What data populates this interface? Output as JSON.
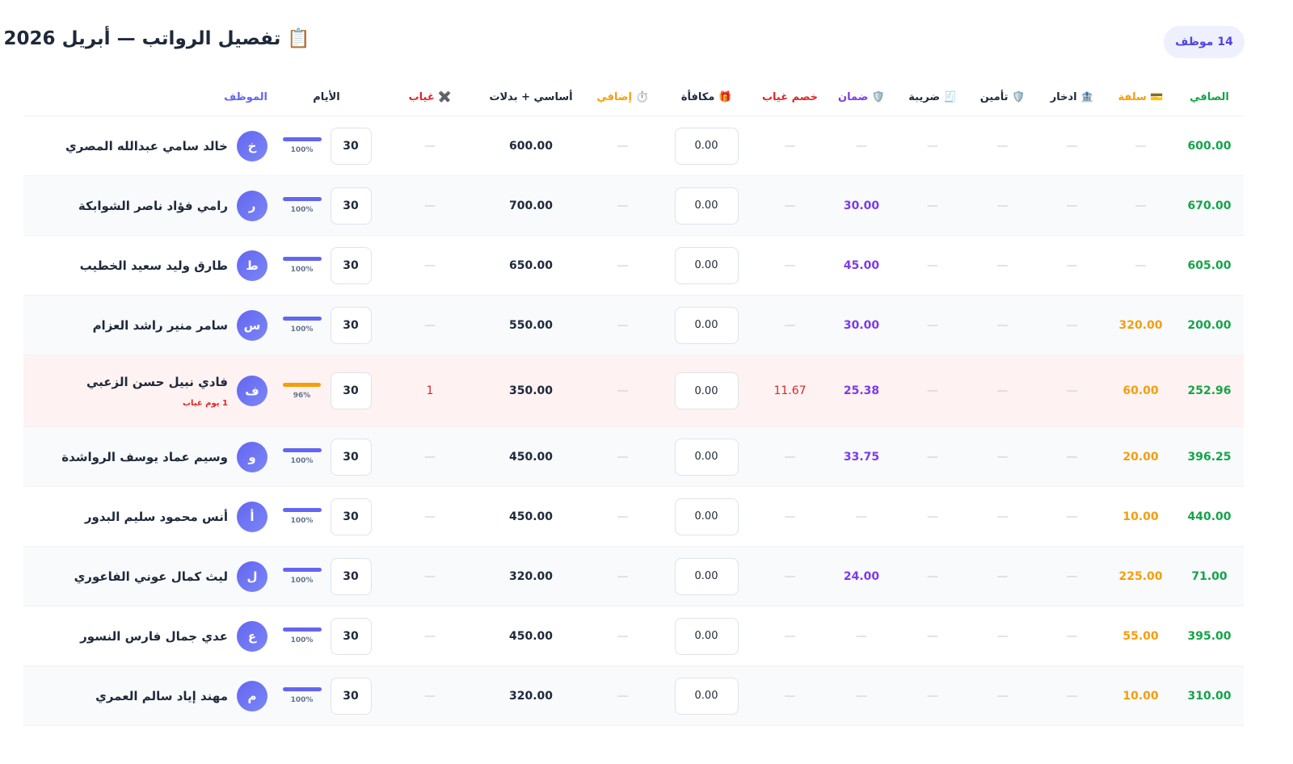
{
  "header": {
    "title": "📋 تفصيل الرواتب — أبريل 2026",
    "employee_count": "14 موظف"
  },
  "columns": {
    "employee": "الموظف",
    "days": "الأيام",
    "absence": "✖️ غياب",
    "base": "أساسي + بدلات",
    "overtime": "⏱️ إضافي",
    "bonus": "🎁 مكافأة",
    "absence_deduction": "خصم غياب",
    "guarantee": "🛡️ ضمان",
    "tax": "🧾 ضريبة",
    "insurance": "🛡️ تأمين",
    "savings": "🏦 ادخار",
    "loan": "💳 سلفة",
    "net": "الصافي"
  },
  "colors": {
    "accent": "#6366f1",
    "net": "#16a34a",
    "loan": "#f59e0b",
    "guarantee": "#7c3aed",
    "deduction": "#dc2626"
  },
  "dash": "—",
  "rows": [
    {
      "initial": "خ",
      "name": "خالد سامي عبدالله المصري",
      "note": "",
      "days": "30",
      "pct": "100%",
      "pct_value": 1.0,
      "absence": "—",
      "base": "600.00",
      "overtime": "—",
      "bonus": "0.00",
      "absence_deduction": "—",
      "guarantee": "—",
      "tax": "—",
      "insurance": "—",
      "savings": "—",
      "loan": "—",
      "net": "600.00"
    },
    {
      "initial": "ر",
      "name": "رامي فؤاد ناصر الشوابكة",
      "note": "",
      "days": "30",
      "pct": "100%",
      "pct_value": 1.0,
      "absence": "—",
      "base": "700.00",
      "overtime": "—",
      "bonus": "0.00",
      "absence_deduction": "—",
      "guarantee": "30.00",
      "tax": "—",
      "insurance": "—",
      "savings": "—",
      "loan": "—",
      "net": "670.00"
    },
    {
      "initial": "ط",
      "name": "طارق وليد سعيد الخطيب",
      "note": "",
      "days": "30",
      "pct": "100%",
      "pct_value": 1.0,
      "absence": "—",
      "base": "650.00",
      "overtime": "—",
      "bonus": "0.00",
      "absence_deduction": "—",
      "guarantee": "45.00",
      "tax": "—",
      "insurance": "—",
      "savings": "—",
      "loan": "—",
      "net": "605.00"
    },
    {
      "initial": "س",
      "name": "سامر منير راشد العزام",
      "note": "",
      "days": "30",
      "pct": "100%",
      "pct_value": 1.0,
      "absence": "—",
      "base": "550.00",
      "overtime": "—",
      "bonus": "0.00",
      "absence_deduction": "—",
      "guarantee": "30.00",
      "tax": "—",
      "insurance": "—",
      "savings": "—",
      "loan": "320.00",
      "net": "200.00"
    },
    {
      "initial": "ف",
      "name": "فادي نبيل حسن الزعبي",
      "note": "1 يوم غياب",
      "days": "30",
      "pct": "96%",
      "pct_value": 0.96,
      "absence": "1",
      "base": "350.00",
      "overtime": "—",
      "bonus": "0.00",
      "absence_deduction": "11.67",
      "guarantee": "25.38",
      "tax": "—",
      "insurance": "—",
      "savings": "—",
      "loan": "60.00",
      "net": "252.96"
    },
    {
      "initial": "و",
      "name": "وسيم عماد يوسف الرواشدة",
      "note": "",
      "days": "30",
      "pct": "100%",
      "pct_value": 1.0,
      "absence": "—",
      "base": "450.00",
      "overtime": "—",
      "bonus": "0.00",
      "absence_deduction": "—",
      "guarantee": "33.75",
      "tax": "—",
      "insurance": "—",
      "savings": "—",
      "loan": "20.00",
      "net": "396.25"
    },
    {
      "initial": "أ",
      "name": "أنس محمود سليم البدور",
      "note": "",
      "days": "30",
      "pct": "100%",
      "pct_value": 1.0,
      "absence": "—",
      "base": "450.00",
      "overtime": "—",
      "bonus": "0.00",
      "absence_deduction": "—",
      "guarantee": "—",
      "tax": "—",
      "insurance": "—",
      "savings": "—",
      "loan": "10.00",
      "net": "440.00"
    },
    {
      "initial": "ل",
      "name": "ليث كمال عوني الفاعوري",
      "note": "",
      "days": "30",
      "pct": "100%",
      "pct_value": 1.0,
      "absence": "—",
      "base": "320.00",
      "overtime": "—",
      "bonus": "0.00",
      "absence_deduction": "—",
      "guarantee": "24.00",
      "tax": "—",
      "insurance": "—",
      "savings": "—",
      "loan": "225.00",
      "net": "71.00"
    },
    {
      "initial": "ع",
      "name": "عدي جمال فارس النسور",
      "note": "",
      "days": "30",
      "pct": "100%",
      "pct_value": 1.0,
      "absence": "—",
      "base": "450.00",
      "overtime": "—",
      "bonus": "0.00",
      "absence_deduction": "—",
      "guarantee": "—",
      "tax": "—",
      "insurance": "—",
      "savings": "—",
      "loan": "55.00",
      "net": "395.00"
    },
    {
      "initial": "م",
      "name": "مهند إياد سالم العمري",
      "note": "",
      "days": "30",
      "pct": "100%",
      "pct_value": 1.0,
      "absence": "—",
      "base": "320.00",
      "overtime": "—",
      "bonus": "0.00",
      "absence_deduction": "—",
      "guarantee": "—",
      "tax": "—",
      "insurance": "—",
      "savings": "—",
      "loan": "10.00",
      "net": "310.00"
    }
  ]
}
